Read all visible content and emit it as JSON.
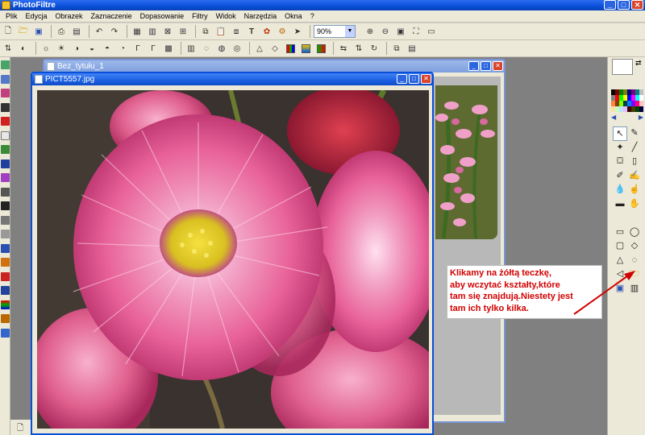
{
  "app": {
    "title": "PhotoFiltre",
    "window_buttons": {
      "minimize": "_",
      "maximize": "□",
      "close": "✕"
    }
  },
  "menu": [
    "Plik",
    "Edycja",
    "Obrazek",
    "Zaznaczenie",
    "Dopasowanie",
    "Filtry",
    "Widok",
    "Narzędzia",
    "Okna",
    "?"
  ],
  "toolbar": {
    "zoom_value": "90%",
    "text_tool_label": "T"
  },
  "windows": {
    "back": {
      "title": "Bez_tytułu_1"
    },
    "front": {
      "title": "PICT5557.jpg"
    }
  },
  "annotation": {
    "lines": [
      "Klikamy na żółtą teczkę,",
      "aby wczytać kształty,które",
      "tam się znajdują.Niestety jest",
      "tam ich tylko kilka."
    ],
    "color": "#d10000"
  },
  "colors": {
    "titlebar": "#0a4fd8",
    "workspace": "#808080",
    "foreground": "#ffffff",
    "background": "#000000"
  }
}
